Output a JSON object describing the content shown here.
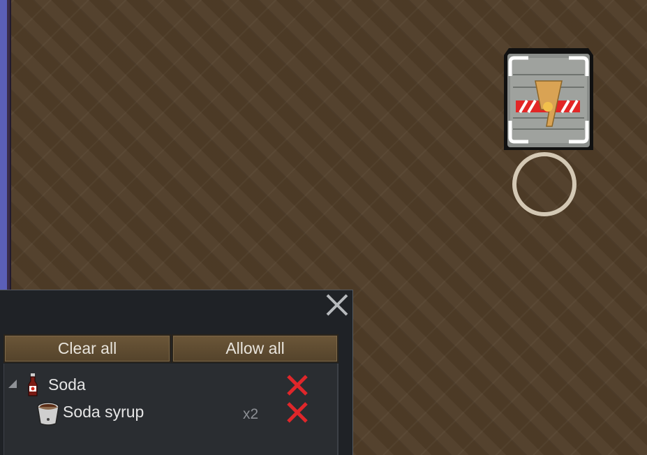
{
  "buttons": {
    "clear_all": "Clear all",
    "allow_all": "Allow all"
  },
  "tree": [
    {
      "label": "Soda",
      "icon": "soda-bottle-icon",
      "expanded": true,
      "status": "disallowed"
    },
    {
      "label": "Soda syrup",
      "icon": "syrup-bucket-icon",
      "count": "x2",
      "status": "disallowed"
    }
  ],
  "colors": {
    "panel_bg": "#1f2226",
    "button_bg": "#5f4d32",
    "disallow_red": "#e0262a"
  }
}
